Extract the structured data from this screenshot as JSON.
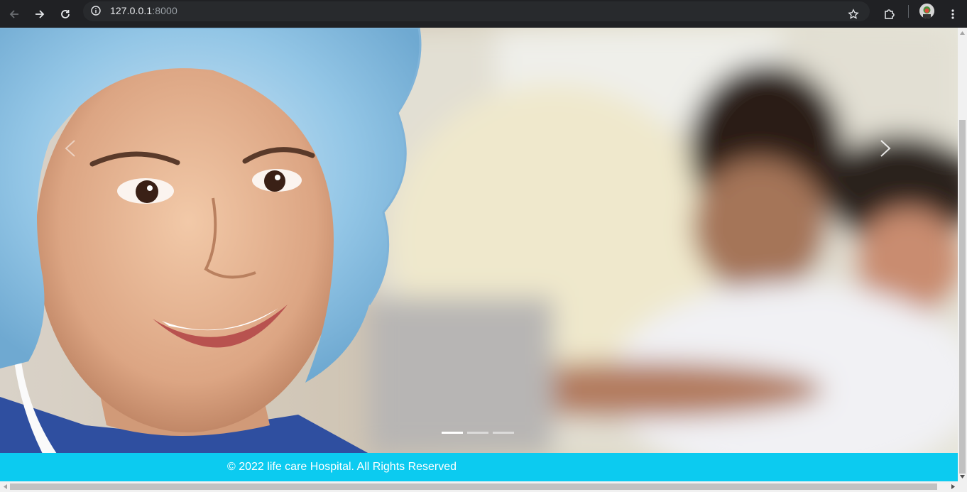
{
  "browser": {
    "url_host": "127.0.0.1",
    "url_port": ":8000"
  },
  "footer": {
    "text": "© 2022 life care Hospital. All Rights Reserved",
    "background": "#0ccbf0"
  },
  "carousel": {
    "slides": 3,
    "active_index": 0
  },
  "icons": {
    "back": "back-arrow-icon",
    "forward": "forward-arrow-icon",
    "reload": "reload-icon",
    "info": "site-info-icon",
    "bookmark": "star-icon",
    "extensions": "puzzle-icon",
    "menu": "kebab-menu-icon"
  }
}
